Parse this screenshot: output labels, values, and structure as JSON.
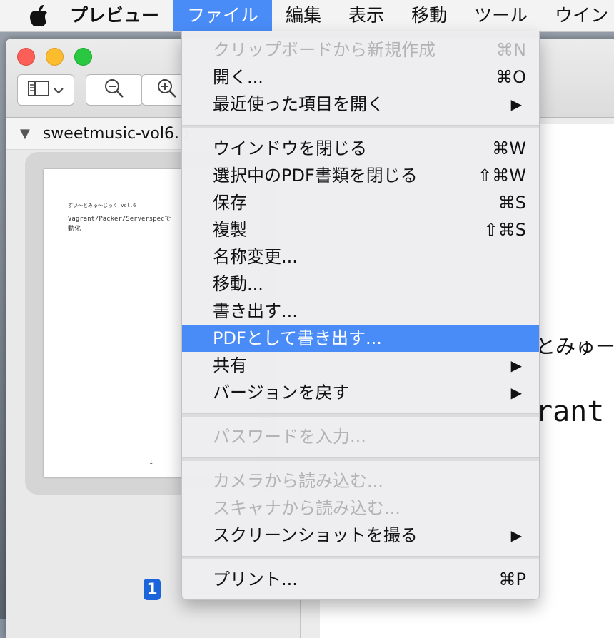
{
  "menubar": {
    "app_name": "プレビュー",
    "items": [
      "ファイル",
      "編集",
      "表示",
      "移動",
      "ツール",
      "ウイン"
    ],
    "active_index": 0
  },
  "window": {
    "sidebar_doc_name": "sweetmusic-vol6.p",
    "page_badge": "1",
    "thumb_lines": [
      "すい〜とみゅ〜じっく vol.6",
      "Vagrant/Packer/Serverspecで",
      "動化",
      "1"
    ],
    "content_text_1": "とみゅー",
    "content_text_2": "rant"
  },
  "file_menu": {
    "items": [
      {
        "label": "クリップボードから新規作成",
        "shortcut": "⌘N",
        "disabled": true
      },
      {
        "label": "開く...",
        "shortcut": "⌘O"
      },
      {
        "label": "最近使った項目を開く",
        "submenu": true
      },
      {
        "label": "ウインドウを閉じる",
        "shortcut": "⌘W"
      },
      {
        "label": "選択中のPDF書類を閉じる",
        "shortcut": "⇧⌘W"
      },
      {
        "label": "保存",
        "shortcut": "⌘S"
      },
      {
        "label": "複製",
        "shortcut": "⇧⌘S"
      },
      {
        "label": "名称変更..."
      },
      {
        "label": "移動..."
      },
      {
        "label": "書き出す..."
      },
      {
        "label": "PDFとして書き出す...",
        "highlighted": true
      },
      {
        "label": "共有",
        "submenu": true
      },
      {
        "label": "バージョンを戻す",
        "submenu": true
      },
      {
        "label": "パスワードを入力...",
        "disabled": true
      },
      {
        "label": "カメラから読み込む...",
        "disabled": true
      },
      {
        "label": "スキャナから読み込む...",
        "disabled": true
      },
      {
        "label": "スクリーンショットを撮る",
        "submenu": true
      },
      {
        "label": "プリント...",
        "shortcut": "⌘P"
      }
    ],
    "submenu_arrow": "▶"
  },
  "colors": {
    "highlight": "#4a8cf7",
    "disabled_text": "#b3b3b5",
    "page_badge": "#1b64d9"
  }
}
